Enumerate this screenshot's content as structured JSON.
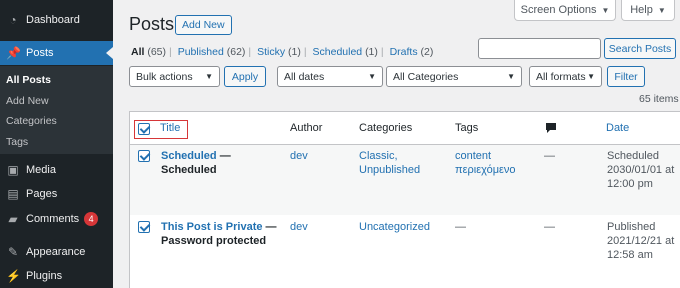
{
  "sidebar": {
    "items": [
      {
        "label": "Dashboard",
        "icon": "dashboard-icon"
      },
      {
        "label": "Posts",
        "icon": "pin-icon"
      },
      {
        "label": "Media",
        "icon": "media-icon"
      },
      {
        "label": "Pages",
        "icon": "pages-icon"
      },
      {
        "label": "Comments",
        "icon": "comments-icon",
        "badge": "4"
      },
      {
        "label": "Appearance",
        "icon": "appearance-icon"
      },
      {
        "label": "Plugins",
        "icon": "plugins-icon"
      }
    ],
    "submenu": [
      "All Posts",
      "Add New",
      "Categories",
      "Tags"
    ]
  },
  "topbar": {
    "screen_options": "Screen Options",
    "help": "Help"
  },
  "header": {
    "title": "Posts",
    "add_new": "Add New"
  },
  "filters": {
    "all": "All",
    "all_count": "(65)",
    "published": "Published",
    "published_count": "(62)",
    "sticky": "Sticky",
    "sticky_count": "(1)",
    "scheduled": "Scheduled",
    "scheduled_count": "(1)",
    "drafts": "Drafts",
    "drafts_count": "(2)",
    "separator": "|"
  },
  "search": {
    "placeholder": "",
    "button": "Search Posts"
  },
  "toolbar": {
    "bulk_actions": "Bulk actions",
    "apply": "Apply",
    "dates": "All dates",
    "categories": "All Categories",
    "formats": "All formats",
    "filter": "Filter",
    "items_count": "65 items"
  },
  "table": {
    "columns": {
      "title": "Title",
      "author": "Author",
      "categories": "Categories",
      "tags": "Tags",
      "date": "Date"
    },
    "rows": [
      {
        "title": "Scheduled",
        "dash": "—",
        "state": "Scheduled",
        "author": "dev",
        "categories_1": "Classic,",
        "categories_2": "Unpublished",
        "tags_1": "content",
        "tags_2": "περιεχόμενο",
        "comments": "—",
        "date_1": "Scheduled",
        "date_2": "2030/01/01 at",
        "date_3": "12:00 pm"
      },
      {
        "title": "This Post is Private",
        "dash": "—",
        "state": "Password protected",
        "author": "dev",
        "categories_1": "Uncategorized",
        "categories_2": "",
        "tags_1": "—",
        "tags_2": "",
        "comments": "—",
        "date_1": "Published",
        "date_2": "2021/12/21 at",
        "date_3": "12:58 am"
      }
    ]
  },
  "colors": {
    "accent": "#2271b1",
    "sidebar": "#1d2327",
    "badge": "#d63638"
  }
}
